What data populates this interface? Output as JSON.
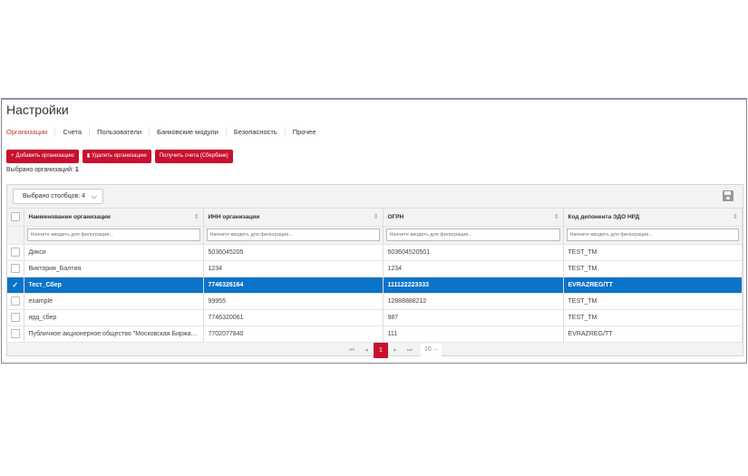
{
  "title": "Настройки",
  "tabs": [
    "Организации",
    "Счета",
    "Пользователи",
    "Банковские модули",
    "Безопасность",
    "Прочее"
  ],
  "buttons": {
    "add": "Добавить организацию",
    "delete": "Удалить организацию",
    "get_accounts": "Получить счета (Сбербанк)"
  },
  "selected": {
    "label": "Выбрано организаций:",
    "count": "1"
  },
  "column_select": "Выбрано столбцов: 4",
  "columns": [
    "Наименование организации",
    "ИНН организации",
    "ОГРН",
    "Код депонента ЭДО НРД"
  ],
  "filter_placeholder": "Начните вводить для фильтрации...",
  "rows": [
    {
      "name": "Дикси",
      "inn": "5036045205",
      "ogrn": "503604520501",
      "code": "TEST_TM",
      "checked": false
    },
    {
      "name": "Виктория_Балтия",
      "inn": "1234",
      "ogrn": "1234",
      "code": "TEST_TM",
      "checked": false
    },
    {
      "name": "Тест_Сбер",
      "inn": "7746326164",
      "ogrn": "111122223333",
      "code": "EVRAZREG/TT",
      "checked": true
    },
    {
      "name": "example",
      "inn": "99955",
      "ogrn": "12888888212",
      "code": "TEST_TM",
      "checked": false
    },
    {
      "name": "нрд_сбер",
      "inn": "7746320061",
      "ogrn": "987",
      "code": "TEST_TM",
      "checked": false
    },
    {
      "name": "Публичное акционерное общество \"Московская Биржа ММВБ-РТС\"",
      "inn": "7702077840",
      "ogrn": "111",
      "code": "EVRAZREG/TT",
      "checked": false
    }
  ],
  "pager": {
    "current": "1",
    "page_size": "10"
  }
}
